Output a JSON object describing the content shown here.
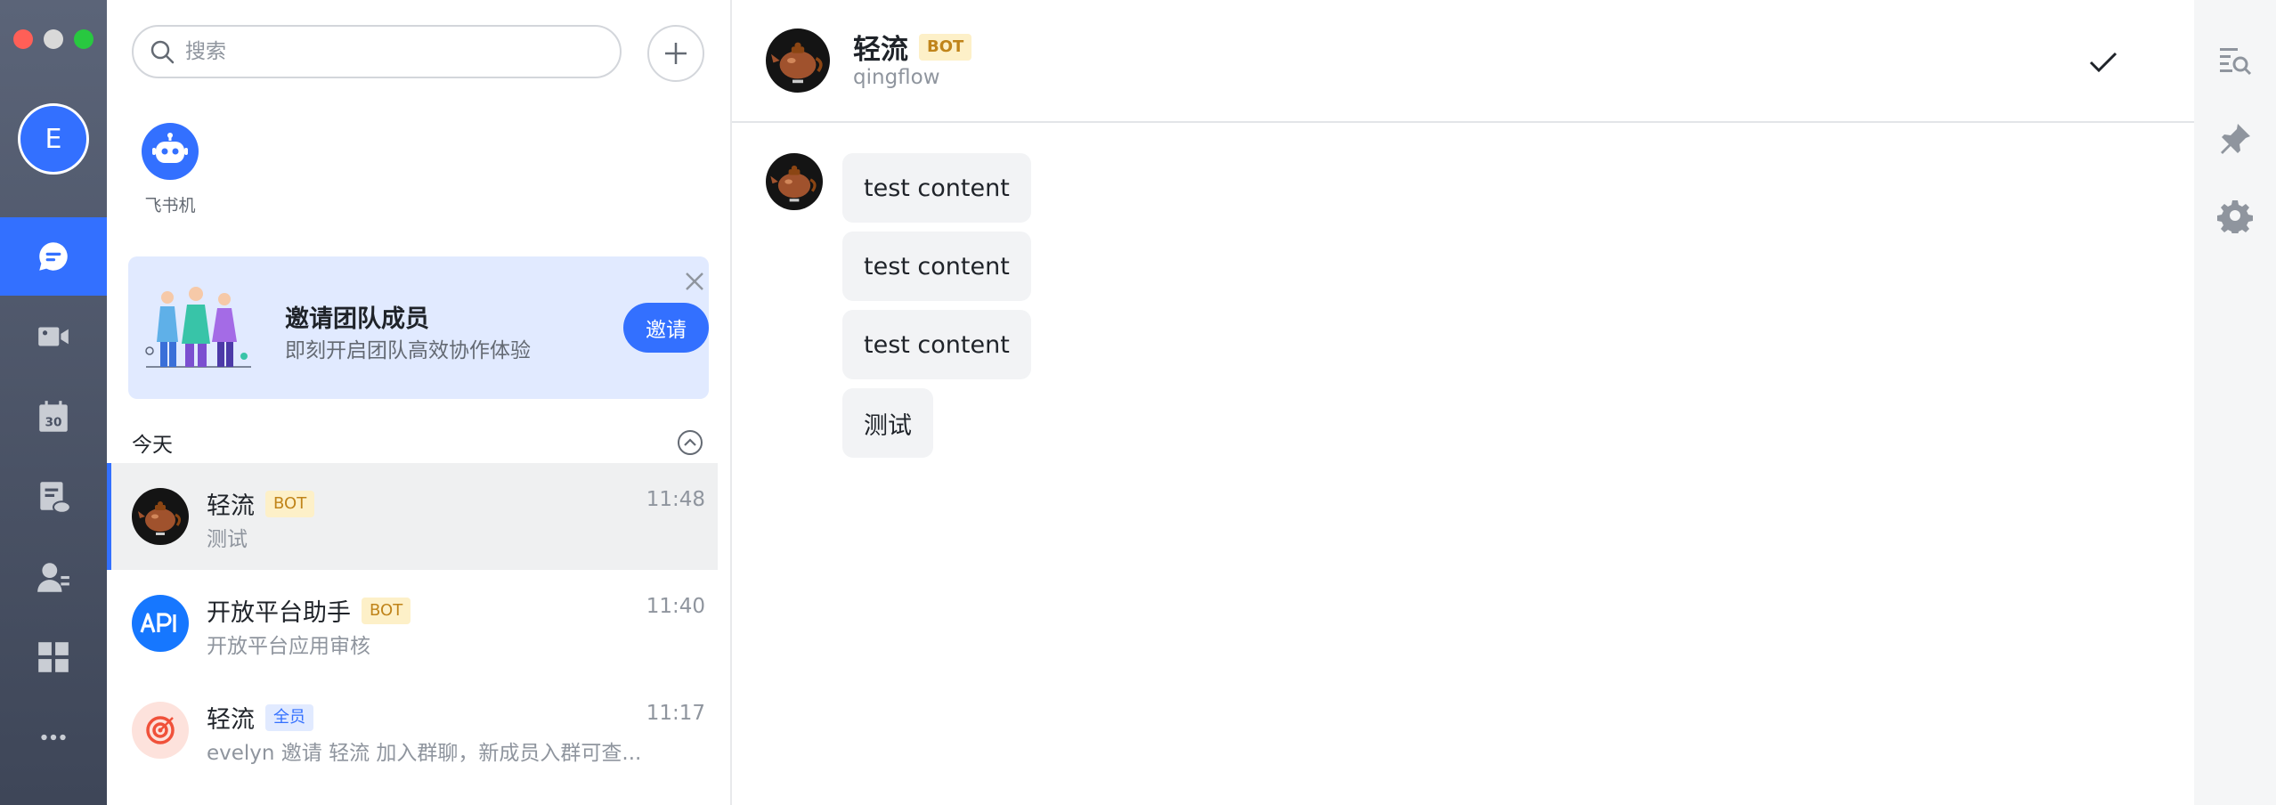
{
  "window": {
    "traffic_lights": [
      "close",
      "minimize",
      "maximize"
    ]
  },
  "rail": {
    "avatar_initial": "E",
    "items": [
      {
        "name": "messages",
        "icon": "chat-bubble-icon",
        "active": true
      },
      {
        "name": "meetings",
        "icon": "video-camera-icon",
        "active": false
      },
      {
        "name": "calendar",
        "icon": "calendar-icon",
        "active": false,
        "badge_text": "30"
      },
      {
        "name": "docs",
        "icon": "cloud-docs-icon",
        "active": false
      },
      {
        "name": "contacts",
        "icon": "contacts-icon",
        "active": false
      },
      {
        "name": "workplace",
        "icon": "apps-grid-icon",
        "active": false
      },
      {
        "name": "more",
        "icon": "more-dots-icon",
        "active": false
      }
    ]
  },
  "search": {
    "placeholder": "搜索"
  },
  "pinned": [
    {
      "label": "飞书机",
      "icon": "robot-icon"
    }
  ],
  "banner": {
    "title": "邀请团队成员",
    "subtitle": "即刻开启团队高效协作体验",
    "invite_label": "邀请"
  },
  "list": {
    "section_title": "今天",
    "chats": [
      {
        "name": "轻流",
        "tag": "BOT",
        "preview": "测试",
        "time": "11:48",
        "selected": true
      },
      {
        "name": "开放平台助手",
        "tag": "BOT",
        "preview": "开放平台应用审核",
        "time": "11:40",
        "selected": false
      },
      {
        "name": "轻流",
        "tag": "全员",
        "preview": "evelyn 邀请 轻流 加入群聊，新成员入群可查...",
        "time": "11:17",
        "selected": false
      }
    ]
  },
  "conversation": {
    "title": "轻流",
    "tag": "BOT",
    "subtitle": "qingflow",
    "messages": [
      "test content",
      "test content",
      "test content",
      "测试"
    ]
  },
  "colors": {
    "accent": "#3370ff",
    "bot_tag_bg": "#fdf0c8",
    "bot_tag_fg": "#c0841a",
    "banner_bg": "#e1eaff"
  }
}
